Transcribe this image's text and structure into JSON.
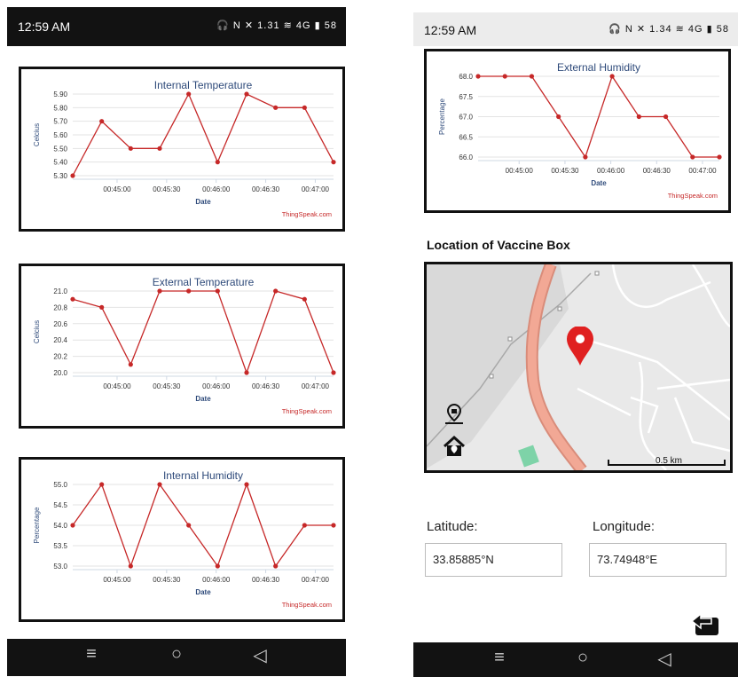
{
  "left_screen": {
    "status": {
      "time": "12:59 AM",
      "icons": "🎧 N ✕ 1.31 ≋ 4G ▮ 58"
    },
    "nav": {
      "menu": "≡",
      "home": "○",
      "back": "◁"
    }
  },
  "right_screen": {
    "status": {
      "time": "12:59 AM",
      "icons": "🎧 N ✕ 1.34 ≋ 4G ▮ 58"
    },
    "location_title": "Location of Vaccine Box",
    "map": {
      "scale_label": "0.5 km"
    },
    "latitude_label": "Latitude:",
    "latitude_value": "33.85885°N",
    "longitude_label": "Longitude:",
    "longitude_value": "73.74948°E",
    "nav": {
      "menu": "≡",
      "home": "○",
      "back": "◁"
    }
  },
  "chart_data": [
    {
      "id": "internal-temp",
      "type": "line",
      "title": "Internal Temperature",
      "xlabel": "Date",
      "ylabel": "Celcius",
      "credit": "ThingSpeak.com",
      "x_ticks": [
        "00:45:00",
        "00:45:30",
        "00:46:00",
        "00:46:30",
        "00:47:00"
      ],
      "y_ticks": [
        "5.30",
        "5.40",
        "5.50",
        "5.60",
        "5.70",
        "5.80",
        "5.90"
      ],
      "ylim": [
        5.3,
        5.9
      ],
      "values": [
        5.3,
        5.7,
        5.5,
        5.5,
        5.9,
        5.4,
        5.9,
        5.8,
        5.8,
        5.4
      ],
      "color": "#c62828"
    },
    {
      "id": "external-temp",
      "type": "line",
      "title": "External Temperature",
      "xlabel": "Date",
      "ylabel": "Celcius",
      "credit": "ThingSpeak.com",
      "x_ticks": [
        "00:45:00",
        "00:45:30",
        "00:46:00",
        "00:46:30",
        "00:47:00"
      ],
      "y_ticks": [
        "20.0",
        "20.2",
        "20.4",
        "20.6",
        "20.8",
        "21.0"
      ],
      "ylim": [
        20.0,
        21.0
      ],
      "values": [
        20.9,
        20.8,
        20.1,
        21.0,
        21.0,
        21.0,
        20.0,
        21.0,
        20.9,
        20.0
      ],
      "color": "#c62828"
    },
    {
      "id": "internal-humidity",
      "type": "line",
      "title": "Internal Humidity",
      "xlabel": "Date",
      "ylabel": "Percentage",
      "credit": "ThingSpeak.com",
      "x_ticks": [
        "00:45:00",
        "00:45:30",
        "00:46:00",
        "00:46:30",
        "00:47:00"
      ],
      "y_ticks": [
        "53.0",
        "53.5",
        "54.0",
        "54.5",
        "55.0"
      ],
      "ylim": [
        53.0,
        55.0
      ],
      "values": [
        54.0,
        55.0,
        53.0,
        55.0,
        54.0,
        53.0,
        55.0,
        53.0,
        54.0,
        54.0
      ],
      "color": "#c62828"
    },
    {
      "id": "external-humidity",
      "type": "line",
      "title": "External Humidity",
      "xlabel": "Date",
      "ylabel": "Percentage",
      "credit": "ThingSpeak.com",
      "x_ticks": [
        "00:45:00",
        "00:45:30",
        "00:46:00",
        "00:46:30",
        "00:47:00"
      ],
      "y_ticks": [
        "66.0",
        "66.5",
        "67.0",
        "67.5",
        "68.0"
      ],
      "ylim": [
        66.0,
        68.0
      ],
      "values": [
        68.0,
        68.0,
        68.0,
        67.0,
        66.0,
        68.0,
        67.0,
        67.0,
        66.0,
        66.0
      ],
      "color": "#c62828"
    }
  ]
}
